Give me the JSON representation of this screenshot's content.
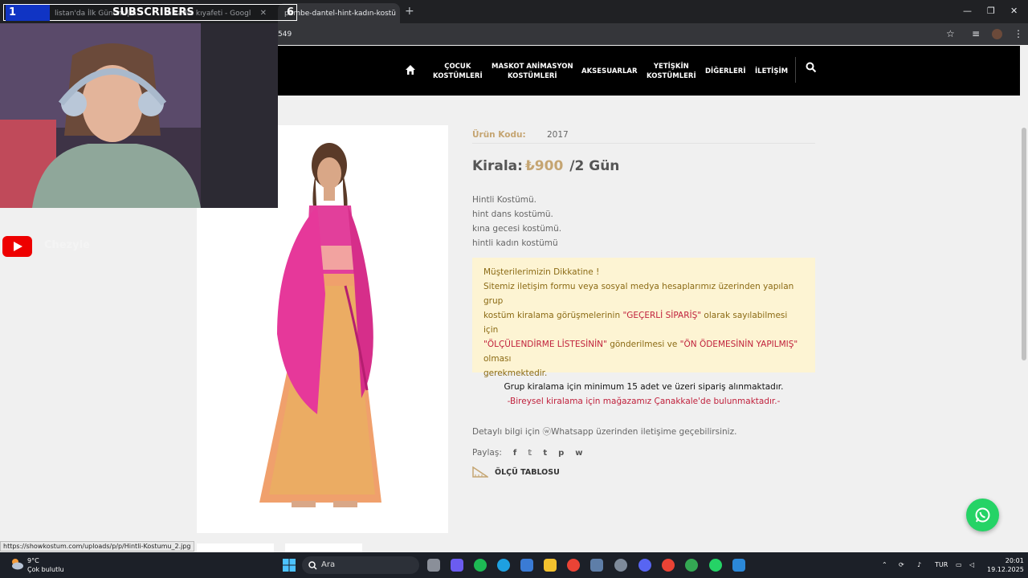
{
  "browser": {
    "tabs": [
      {
        "label": "listan'da İlk Günüm | K",
        "active": false
      },
      {
        "label": "n kadın kıyafeti - Googl",
        "active": false
      },
      {
        "label": "pembe-dantel-hint-kadın-kostü",
        "active": true
      }
    ],
    "address": "549",
    "status_url": "https://showkostum.com/uploads/p/p/Hintli-Kostumu_2.jpg"
  },
  "overlay": {
    "sub_number": "1",
    "sub_label": "SUBSCRIBERS",
    "sub_count": "6",
    "youtube_name": "Chezyie"
  },
  "nav": {
    "items": [
      {
        "label": "ÇOCUK\nKOSTÜMLERİ"
      },
      {
        "label": "MASKOT ANİMASYON\nKOSTÜMLERİ"
      },
      {
        "label": "AKSESUARLAR"
      },
      {
        "label": "YETİŞKİN\nKOSTÜMLERİ"
      },
      {
        "label": "DİĞERLERİ"
      },
      {
        "label": "İLETİŞİM"
      }
    ]
  },
  "product": {
    "code_label": "Ürün Kodu:",
    "code_value": "2017",
    "price_label": "Kirala:",
    "price_amount": "₺900",
    "price_period": "/2 Gün",
    "desc_lines": [
      "Hintli Kostümü.",
      "hint dans kostümü.",
      "kına gecesi kostümü.",
      "hintli kadın kostümü"
    ],
    "notice": {
      "title": "Müşterilerimizin Dikkatine !",
      "l1": "Sitemiz iletişim formu veya sosyal medya hesaplarımız üzerinden yapılan grup",
      "l2a": "kostüm kiralama görüşmelerinin ",
      "l2b": "\"GEÇERLİ SİPARİŞ\"",
      "l2c": " olarak sayılabilmesi için",
      "l3a": "\"ÖLÇÜLENDİRME LİSTESİNİN\"",
      "l3b": " gönderilmesi ve ",
      "l3c": "\"ÖN ÖDEMESİNİN YAPILMIŞ\"",
      "l3d": " olması",
      "l4": "gerekmektedir."
    },
    "group_note": "Grup kiralama için minimum 15 adet ve üzeri sipariş alınmaktadır.",
    "individual_note": "-Bireysel kiralama için mağazamız Çanakkale'de bulunmaktadır.-",
    "detail_text": "Detaylı bilgi için ⓦWhatsapp üzerinden iletişime geçebilirsiniz.",
    "share_label": "Paylaş:",
    "share_icons": [
      "f",
      "𝕥",
      "t",
      "p",
      "w"
    ],
    "size_table": "ÖLÇÜ TABLOSU"
  },
  "taskbar": {
    "temp": "9°C",
    "weather": "Çok bulutlu",
    "search_placeholder": "Ara",
    "lang": "TUR",
    "time": "20:01",
    "date": "19.12.2025"
  },
  "colors": {
    "accent": "#c5a572",
    "red": "#c0213c",
    "notice_bg": "#fdf4d3",
    "whatsapp": "#25d366"
  }
}
